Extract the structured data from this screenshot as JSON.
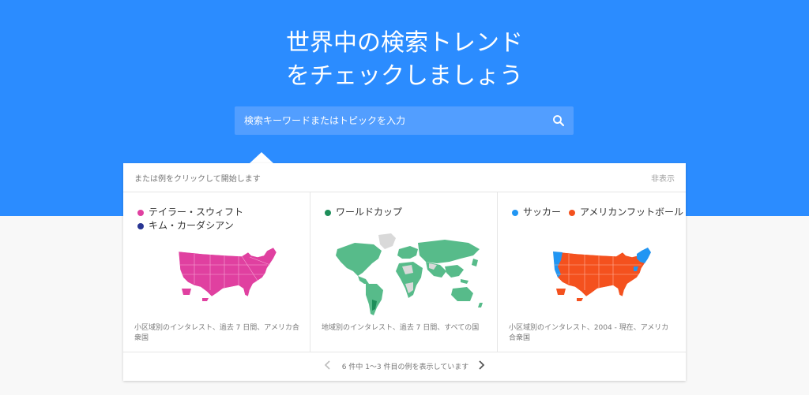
{
  "hero": {
    "title_line1": "世界中の検索トレンド",
    "title_line2": "をチェックしましょう"
  },
  "search": {
    "placeholder": "検索キーワードまたはトピックを入力",
    "icon": "search-icon"
  },
  "examples_panel": {
    "prompt": "または例をクリックして開始します",
    "hide_label": "非表示",
    "pager_text": "6 件中 1〜3 件目の例を表示しています",
    "prev_icon": "chevron-left-icon",
    "next_icon": "chevron-right-icon"
  },
  "examples": [
    {
      "terms": [
        {
          "label": "テイラー・スウィフト",
          "color": "#e040a0"
        },
        {
          "label": "キム・カーダシアン",
          "color": "#283593"
        }
      ],
      "caption": "小区域別のインタレスト、過去 7 日間、アメリカ合衆国"
    },
    {
      "terms": [
        {
          "label": "ワールドカップ",
          "color": "#1e8e5a"
        }
      ],
      "caption": "地域別のインタレスト、過去 7 日間、すべての国"
    },
    {
      "terms": [
        {
          "label": "サッカー",
          "color": "#2196f3"
        },
        {
          "label": "アメリカンフットボール",
          "color": "#f4511e"
        }
      ],
      "caption": "小区域別のインタレスト、2004 - 現在、アメリカ合衆国"
    }
  ],
  "colors": {
    "hero_bg": "#2b8cff",
    "search_bg": "#529eff",
    "world_light": "#57bb8a",
    "world_dark": "#1e8e5a",
    "world_none": "#d9d9d9"
  }
}
